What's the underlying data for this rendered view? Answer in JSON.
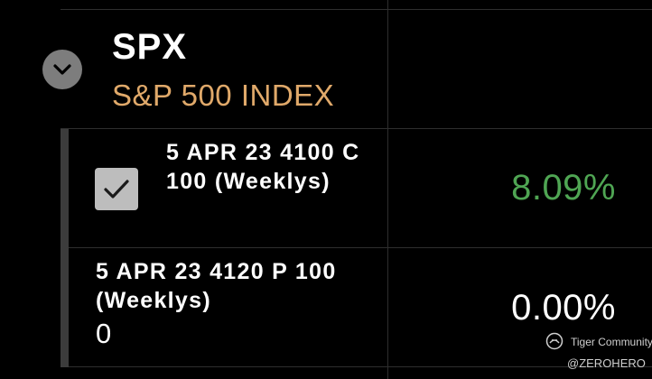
{
  "header": {
    "symbol": "SPX",
    "name": "S&P 500 INDEX"
  },
  "positions": [
    {
      "line1": "5 APR 23 4100 C",
      "line2": "100 (Weeklys)",
      "checked": true,
      "percent": "8.09%",
      "percent_color": "#4fa553"
    },
    {
      "line1": "5 APR 23 4120 P 100",
      "line2": "(Weeklys)",
      "quantity": "0",
      "percent": "0.00%",
      "percent_color": "#ffffff"
    }
  ],
  "watermark": {
    "brand": "Tiger Community",
    "handle": "@ZEROHERO",
    "icon": "tiger-logo-icon"
  },
  "colors": {
    "background": "#000000",
    "index_name": "#e0a96a",
    "gain": "#4fa553",
    "collapse_button": "#7d7d7d",
    "checkbox": "#bdbdbd",
    "row_marker": "#3c3c3c"
  },
  "icons": {
    "collapse": "chevron-down-icon",
    "checkbox": "checkmark-icon"
  }
}
